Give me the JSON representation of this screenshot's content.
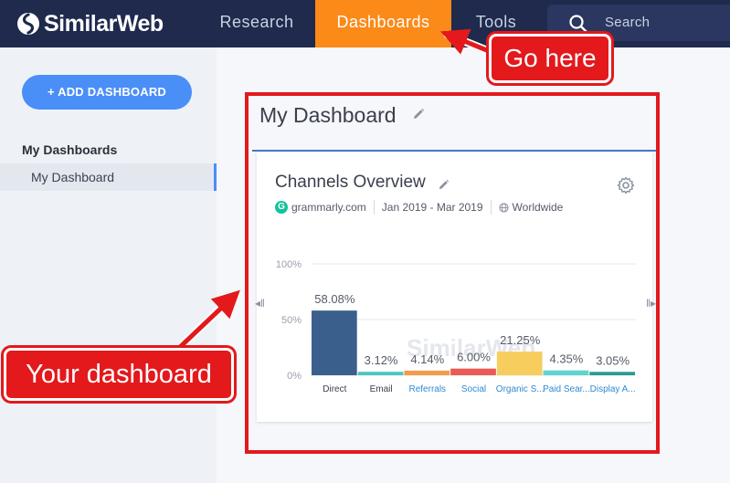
{
  "brand": {
    "name": "SimilarWeb"
  },
  "nav": {
    "research": "Research",
    "dashboards": "Dashboards",
    "tools": "Tools",
    "search_label": "Search",
    "active_color": "#fb8a18"
  },
  "sidebar": {
    "add_button": "+ ADD DASHBOARD",
    "heading": "My Dashboards",
    "items": [
      {
        "label": "My Dashboard",
        "active": true
      }
    ]
  },
  "dashboard": {
    "title": "My Dashboard",
    "widget": {
      "title": "Channels Overview",
      "site": "grammarly.com",
      "site_badge": "G",
      "date_range": "Jan 2019 - Mar 2019",
      "region": "Worldwide"
    }
  },
  "chart_data": {
    "type": "bar",
    "title": "",
    "watermark": "SimilarWeb",
    "categories": [
      "Direct",
      "Email",
      "Referrals",
      "Social",
      "Organic S...",
      "Paid Sear...",
      "Display A..."
    ],
    "values": [
      58.08,
      3.12,
      4.14,
      6.0,
      21.25,
      4.35,
      3.05
    ],
    "value_labels": [
      "58.08%",
      "3.12%",
      "4.14%",
      "6.00%",
      "21.25%",
      "4.35%",
      "3.05%"
    ],
    "colors": [
      "#3b5f8d",
      "#4cc5c1",
      "#f49a4b",
      "#ea5b55",
      "#f7ce5e",
      "#5fd4d0",
      "#2b9a91"
    ],
    "category_label_colors": [
      "#3a3f4c",
      "#3a3f4c",
      "#2f8ad3",
      "#2f8ad3",
      "#2f8ad3",
      "#2f8ad3",
      "#2f8ad3"
    ],
    "y_ticks": [
      "100%",
      "50%",
      "0%"
    ],
    "ylim": [
      0,
      100
    ],
    "grid": true
  },
  "annotations": {
    "go_here": "Go here",
    "your_dashboard": "Your dashboard",
    "color": "#e3191c"
  }
}
